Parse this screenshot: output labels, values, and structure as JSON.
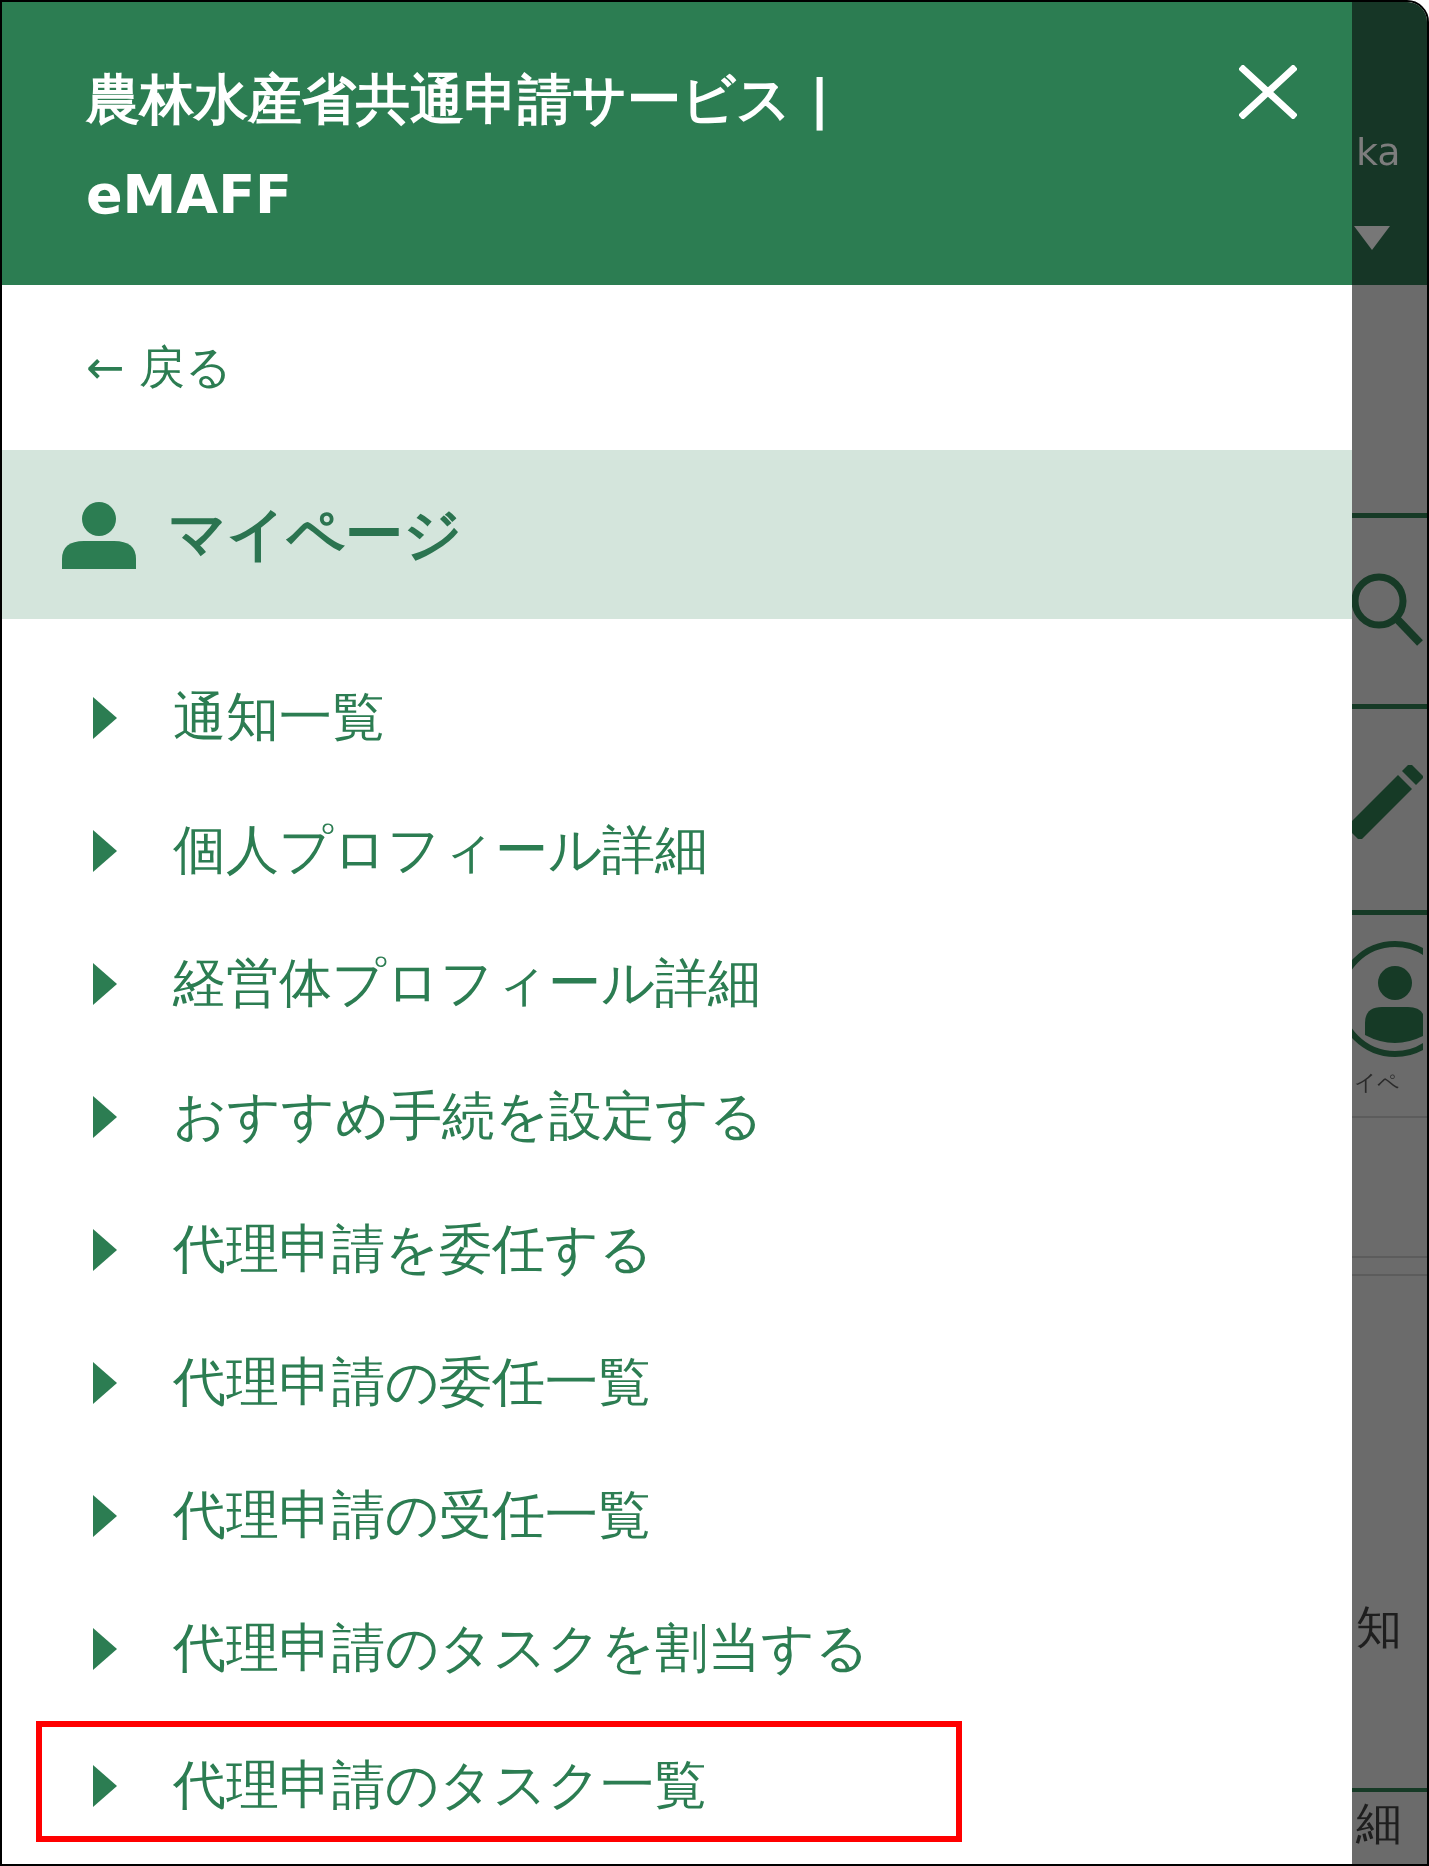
{
  "drawer": {
    "title": "農林水産省共通申請サービス | eMAFF",
    "back_link": "← 戻る",
    "section_title": "マイページ"
  },
  "menu_items": [
    {
      "label": "通知一覧",
      "highlighted": false
    },
    {
      "label": "個人プロフィール詳細",
      "highlighted": false
    },
    {
      "label": "経営体プロフィール詳細",
      "highlighted": false
    },
    {
      "label": "おすすめ手続を設定する",
      "highlighted": false
    },
    {
      "label": "代理申請を委任する",
      "highlighted": false
    },
    {
      "label": "代理申請の委任一覧",
      "highlighted": false
    },
    {
      "label": "代理申請の受任一覧",
      "highlighted": false
    },
    {
      "label": "代理申請のタスクを割当する",
      "highlighted": false
    },
    {
      "label": "代理申請のタスク一覧",
      "highlighted": true
    }
  ],
  "backdrop": {
    "header_text": "ka",
    "nav_label": "イペ",
    "page_texts": [
      "知",
      "細"
    ]
  }
}
